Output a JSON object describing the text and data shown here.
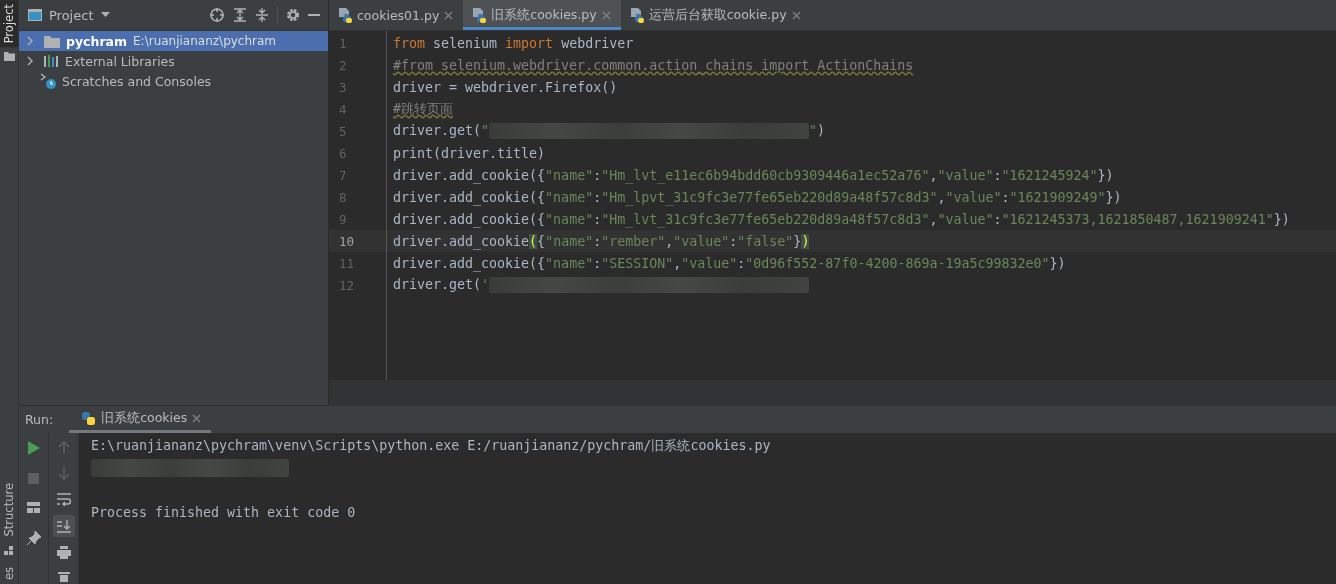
{
  "side_stripe": {
    "top": [
      {
        "label": "Project",
        "selected": true
      }
    ],
    "bottom": [
      {
        "label": "Structure",
        "selected": false
      },
      {
        "label": "es",
        "selected": false
      }
    ]
  },
  "project_panel": {
    "title": "Project",
    "tree": [
      {
        "kind": "project",
        "name": "pychram",
        "path": "E:\\ruanjiananz\\pychram",
        "selected": true
      },
      {
        "kind": "libraries",
        "name": "External Libraries",
        "selected": false
      },
      {
        "kind": "scratches",
        "name": "Scratches and Consoles",
        "selected": false
      }
    ]
  },
  "editor_tabs": [
    {
      "label": "cookies01.py",
      "selected": false
    },
    {
      "label": "旧系统cookies.py",
      "selected": true
    },
    {
      "label": "运营后台获取cookie.py",
      "selected": false
    }
  ],
  "editor_lines": [
    {
      "number": "1",
      "current": false,
      "tokens": [
        {
          "kind": "kw",
          "text": "from"
        },
        {
          "kind": "plain",
          "text": " selenium "
        },
        {
          "kind": "kw",
          "text": "import"
        },
        {
          "kind": "plain",
          "text": " webdriver"
        }
      ]
    },
    {
      "number": "2",
      "current": false,
      "tokens": [
        {
          "kind": "comment",
          "text": "#from selenium.webdriver.common.action_chains import ActionChains"
        }
      ]
    },
    {
      "number": "3",
      "current": false,
      "tokens": [
        {
          "kind": "plain",
          "text": "driver = webdriver.Firefox()"
        }
      ]
    },
    {
      "number": "4",
      "current": false,
      "tokens": [
        {
          "kind": "comment",
          "text": "#跳转页面"
        }
      ]
    },
    {
      "number": "5",
      "current": false,
      "tokens": [
        {
          "kind": "plain",
          "text": "driver.get("
        },
        {
          "kind": "str",
          "text": "\""
        },
        {
          "kind": "redacted"
        },
        {
          "kind": "str",
          "text": "\""
        },
        {
          "kind": "plain",
          "text": ")"
        }
      ]
    },
    {
      "number": "6",
      "current": false,
      "tokens": [
        {
          "kind": "plain",
          "text": "print(driver.title)"
        }
      ]
    },
    {
      "number": "7",
      "current": false,
      "tokens": [
        {
          "kind": "plain",
          "text": "driver.add_cookie({"
        },
        {
          "kind": "str",
          "text": "\"name\""
        },
        {
          "kind": "plain",
          "text": ":"
        },
        {
          "kind": "str",
          "text": "\"Hm_lvt_e11ec6b94bdd60cb9309446a1ec52a76\""
        },
        {
          "kind": "plain",
          "text": ","
        },
        {
          "kind": "str",
          "text": "\"value\""
        },
        {
          "kind": "plain",
          "text": ":"
        },
        {
          "kind": "str",
          "text": "\"1621245924\""
        },
        {
          "kind": "plain",
          "text": "})"
        }
      ]
    },
    {
      "number": "8",
      "current": false,
      "tokens": [
        {
          "kind": "plain",
          "text": "driver.add_cookie({"
        },
        {
          "kind": "str",
          "text": "\"name\""
        },
        {
          "kind": "plain",
          "text": ":"
        },
        {
          "kind": "str",
          "text": "\"Hm_lpvt_31c9fc3e77fe65eb220d89a48f57c8d3\""
        },
        {
          "kind": "plain",
          "text": ","
        },
        {
          "kind": "str",
          "text": "\"value\""
        },
        {
          "kind": "plain",
          "text": ":"
        },
        {
          "kind": "str",
          "text": "\"1621909249\""
        },
        {
          "kind": "plain",
          "text": "})"
        }
      ]
    },
    {
      "number": "9",
      "current": false,
      "tokens": [
        {
          "kind": "plain",
          "text": "driver.add_cookie({"
        },
        {
          "kind": "str",
          "text": "\"name\""
        },
        {
          "kind": "plain",
          "text": ":"
        },
        {
          "kind": "str",
          "text": "\"Hm_lvt_31c9fc3e77fe65eb220d89a48f57c8d3\""
        },
        {
          "kind": "plain",
          "text": ","
        },
        {
          "kind": "str",
          "text": "\"value\""
        },
        {
          "kind": "plain",
          "text": ":"
        },
        {
          "kind": "str",
          "text": "\"1621245373,1621850487,1621909241\""
        },
        {
          "kind": "plain",
          "text": "})"
        }
      ]
    },
    {
      "number": "10",
      "current": true,
      "tokens": [
        {
          "kind": "plain",
          "text": "driver.add_cookie"
        },
        {
          "kind": "brace",
          "text": "("
        },
        {
          "kind": "plain",
          "text": "{"
        },
        {
          "kind": "str",
          "text": "\"name\""
        },
        {
          "kind": "plain",
          "text": ":"
        },
        {
          "kind": "str",
          "text": "\"rember\""
        },
        {
          "kind": "plain",
          "text": ","
        },
        {
          "kind": "str",
          "text": "\"value\""
        },
        {
          "kind": "plain",
          "text": ":"
        },
        {
          "kind": "str",
          "text": "\"false\""
        },
        {
          "kind": "plain",
          "text": "}"
        },
        {
          "kind": "brace",
          "text": ")"
        }
      ]
    },
    {
      "number": "11",
      "current": false,
      "tokens": [
        {
          "kind": "plain",
          "text": "driver.add_cookie({"
        },
        {
          "kind": "str",
          "text": "\"name\""
        },
        {
          "kind": "plain",
          "text": ":"
        },
        {
          "kind": "str",
          "text": "\"SESSION\""
        },
        {
          "kind": "plain",
          "text": ","
        },
        {
          "kind": "str",
          "text": "\"value\""
        },
        {
          "kind": "plain",
          "text": ":"
        },
        {
          "kind": "str",
          "text": "\"0d96f552-87f0-4200-869a-19a5c99832e0\""
        },
        {
          "kind": "plain",
          "text": "})"
        }
      ]
    },
    {
      "number": "12",
      "current": false,
      "tokens": [
        {
          "kind": "plain",
          "text": "driver.get("
        },
        {
          "kind": "str",
          "text": "'"
        },
        {
          "kind": "redacted"
        }
      ]
    }
  ],
  "run_panel": {
    "label": "Run:",
    "tab": "旧系统cookies",
    "output": [
      {
        "kind": "text",
        "text": "E:\\ruanjiananz\\pychram\\venv\\Scripts\\python.exe E:/ruanjiananz/pychram/旧系统cookies.py"
      },
      {
        "kind": "redacted"
      },
      {
        "kind": "blank"
      },
      {
        "kind": "text",
        "text": "Process finished with exit code 0"
      }
    ]
  }
}
